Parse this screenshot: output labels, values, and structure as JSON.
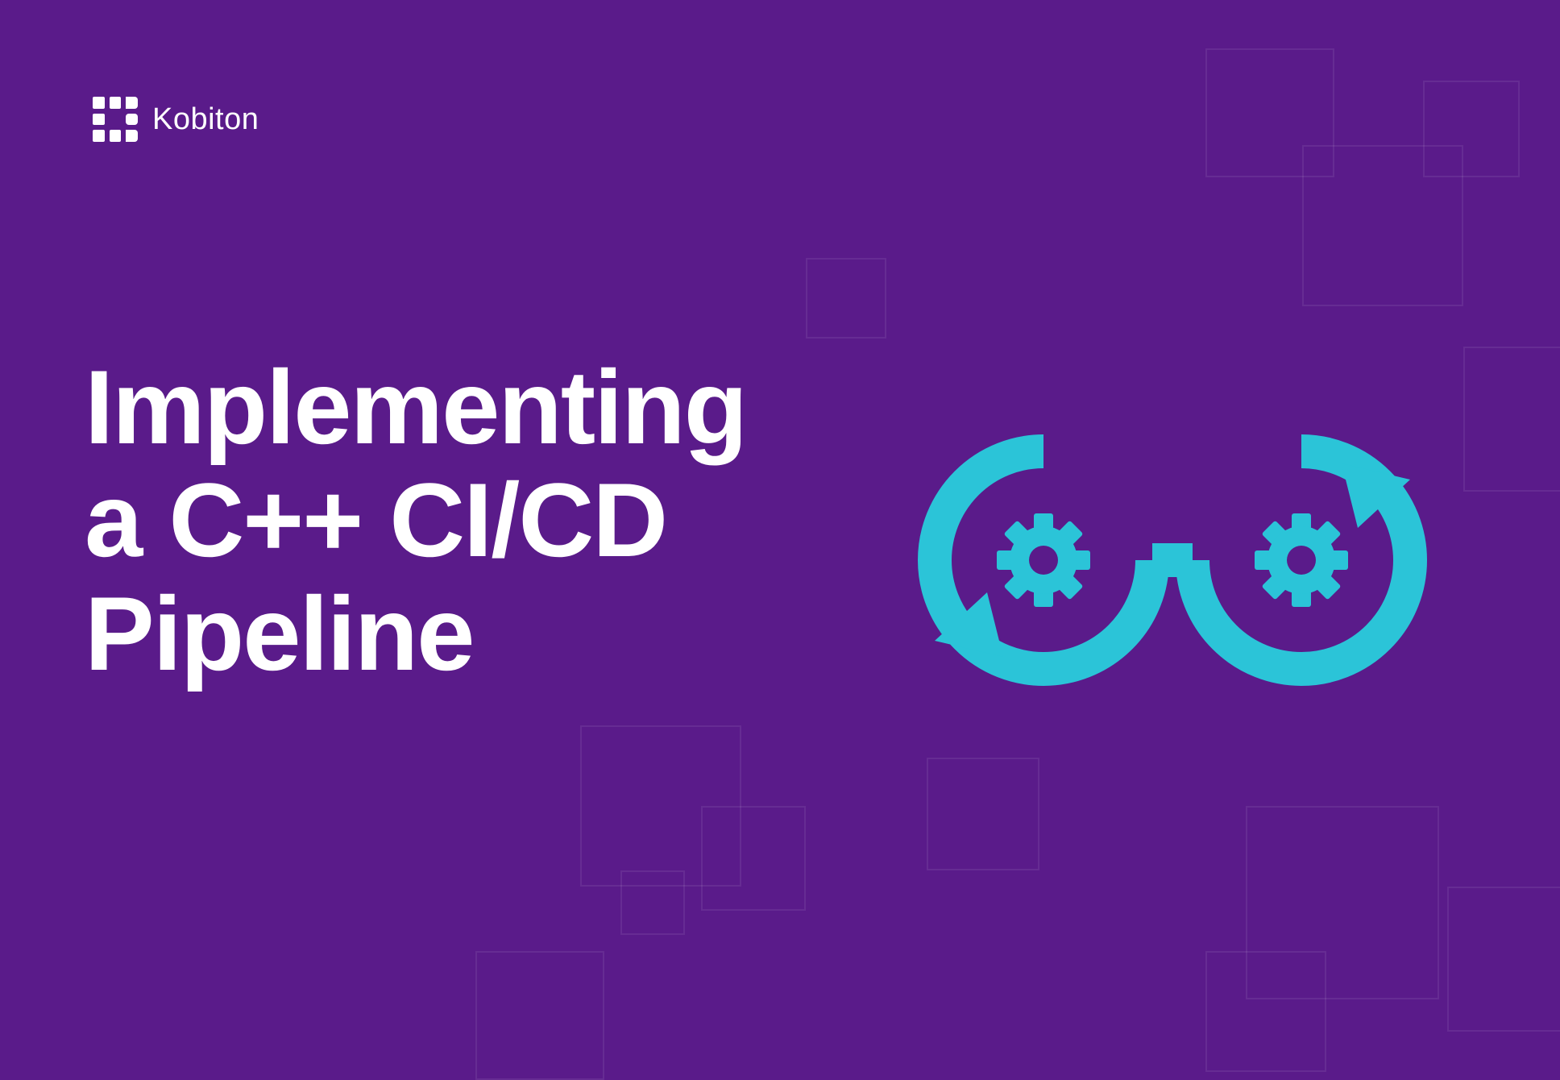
{
  "brand": {
    "name": "Kobiton"
  },
  "headline": {
    "line1": "Implementing",
    "line2": "a C++ CI/CD",
    "line3": "Pipeline"
  },
  "colors": {
    "background": "#5a1b8a",
    "accent": "#2bc4d8",
    "text": "#ffffff"
  }
}
